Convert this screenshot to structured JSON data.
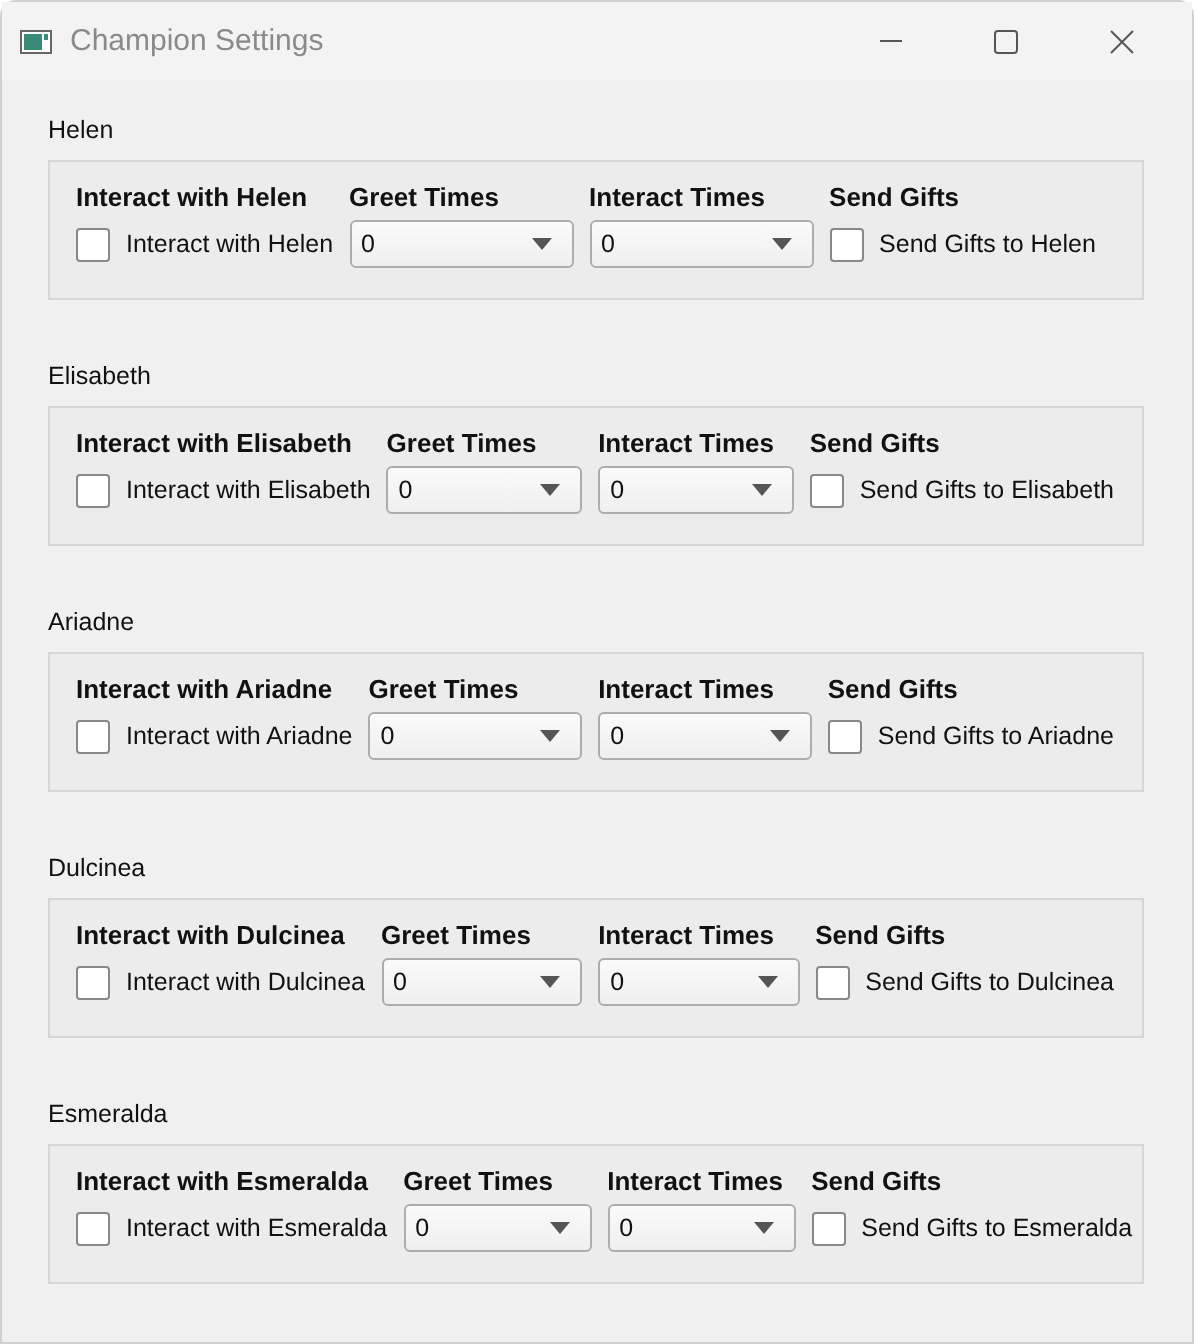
{
  "window": {
    "title": "Champion Settings"
  },
  "groups": [
    {
      "title": "Helen",
      "interact_header": "Interact with Helen",
      "interact_label": "Interact with Helen",
      "interact_checked": false,
      "greet_header": "Greet Times",
      "greet_value": "0",
      "times_header": "Interact Times",
      "times_value": "0",
      "gifts_header": "Send Gifts",
      "gifts_label": "Send Gifts to Helen",
      "gifts_checked": false
    },
    {
      "title": "Elisabeth",
      "interact_header": "Interact with Elisabeth",
      "interact_label": "Interact with Elisabeth",
      "interact_checked": false,
      "greet_header": "Greet Times",
      "greet_value": "0",
      "times_header": "Interact Times",
      "times_value": "0",
      "gifts_header": "Send Gifts",
      "gifts_label": "Send Gifts to Elisabeth",
      "gifts_checked": false
    },
    {
      "title": "Ariadne",
      "interact_header": "Interact with Ariadne",
      "interact_label": "Interact with Ariadne",
      "interact_checked": false,
      "greet_header": "Greet Times",
      "greet_value": "0",
      "times_header": "Interact Times",
      "times_value": "0",
      "gifts_header": "Send Gifts",
      "gifts_label": "Send Gifts to Ariadne",
      "gifts_checked": false
    },
    {
      "title": "Dulcinea",
      "interact_header": "Interact with Dulcinea",
      "interact_label": "Interact with Dulcinea",
      "interact_checked": false,
      "greet_header": "Greet Times",
      "greet_value": "0",
      "times_header": "Interact Times",
      "times_value": "0",
      "gifts_header": "Send Gifts",
      "gifts_label": "Send Gifts to Dulcinea",
      "gifts_checked": false
    },
    {
      "title": "Esmeralda",
      "interact_header": "Interact with Esmeralda",
      "interact_label": "Interact with Esmeralda",
      "interact_checked": false,
      "greet_header": "Greet Times",
      "greet_value": "0",
      "times_header": "Interact Times",
      "times_value": "0",
      "gifts_header": "Send Gifts",
      "gifts_label": "Send Gifts to Esmeralda",
      "gifts_checked": false
    }
  ]
}
